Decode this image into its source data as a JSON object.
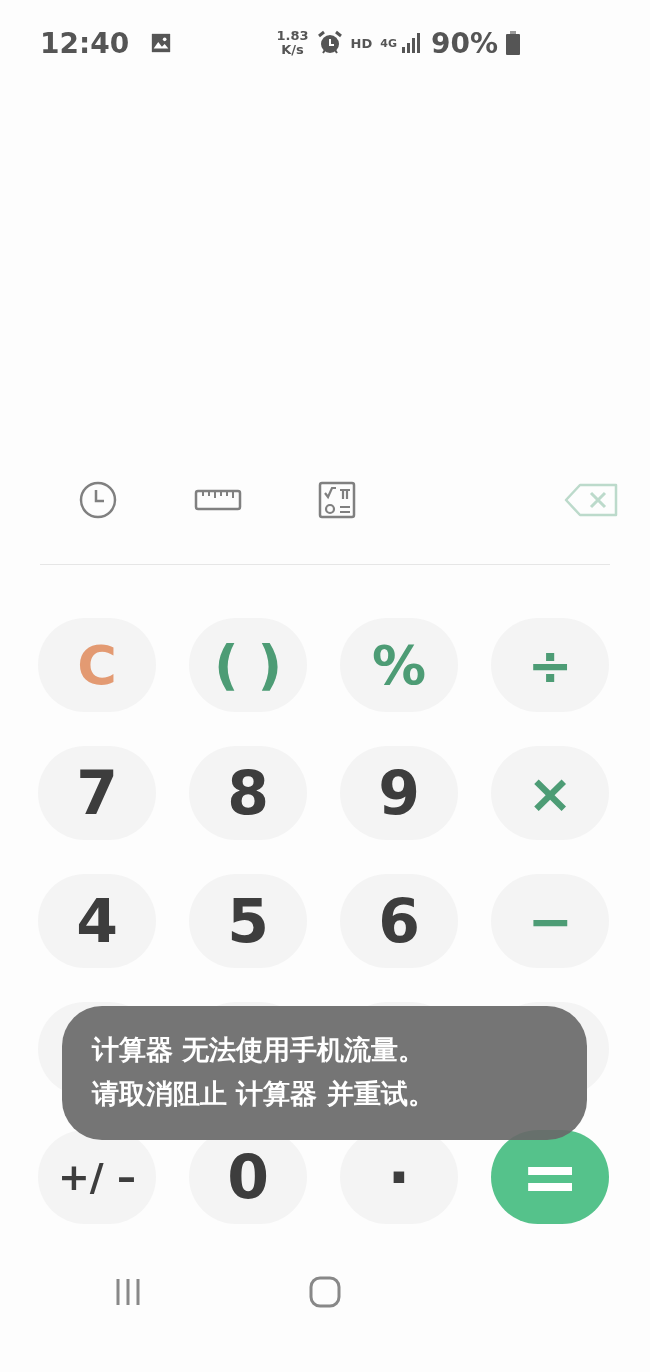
{
  "status_bar": {
    "time": "12:40",
    "net_speed": "1.83",
    "net_speed_unit": "K/s",
    "network_label": "HD",
    "network_type": "4G",
    "battery": "90%"
  },
  "toolbar": {
    "backspace": {
      "disabled": true
    }
  },
  "keys": [
    {
      "label": "C",
      "kind": "clear"
    },
    {
      "label": "( )",
      "kind": "operator"
    },
    {
      "label": "%",
      "kind": "operator"
    },
    {
      "label": "÷",
      "kind": "operator"
    },
    {
      "label": "7",
      "kind": "digit"
    },
    {
      "label": "8",
      "kind": "digit"
    },
    {
      "label": "9",
      "kind": "digit"
    },
    {
      "label": "×",
      "kind": "operator"
    },
    {
      "label": "4",
      "kind": "digit"
    },
    {
      "label": "5",
      "kind": "digit"
    },
    {
      "label": "6",
      "kind": "digit"
    },
    {
      "label": "−",
      "kind": "operator"
    },
    {
      "kind": "digit"
    },
    {
      "kind": "digit"
    },
    {
      "kind": "digit"
    },
    {
      "kind": "operator"
    },
    {
      "label": "+/ –",
      "kind": "sign"
    },
    {
      "label": "0",
      "kind": "digit"
    },
    {
      "label": "·",
      "kind": "digit"
    },
    {
      "label": "=",
      "kind": "equals"
    }
  ],
  "toast": {
    "lines": [
      "计算器 无法使用手机流量。",
      "请取消阻止 计算器 并重试。"
    ]
  }
}
